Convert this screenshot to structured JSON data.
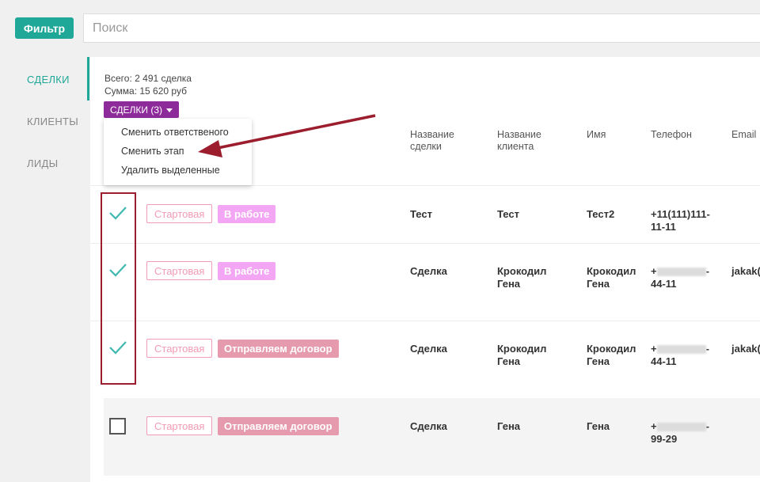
{
  "topbar": {
    "filter_label": "Фильтр",
    "search_placeholder": "Поиск"
  },
  "sidebar": {
    "items": [
      {
        "label": "СДЕЛКИ",
        "active": true
      },
      {
        "label": "КЛИЕНТЫ",
        "active": false
      },
      {
        "label": "ЛИДЫ",
        "active": false
      }
    ]
  },
  "summary": {
    "total": "Всего: 2 491 сделка",
    "sum": "Сумма: 15 620 руб"
  },
  "deals_button": "СДЕЛКИ (3)",
  "dropdown": {
    "items": [
      "Сменить ответственого",
      "Сменить этап",
      "Удалить выделенные"
    ]
  },
  "columns": {
    "deal_name": [
      "Название",
      "сделки"
    ],
    "client_name": [
      "Название",
      "клиента"
    ],
    "name": "Имя",
    "phone": "Телефон",
    "email": "Email"
  },
  "rows": [
    {
      "checked": true,
      "stage_start": "Стартовая",
      "stage": "В работе",
      "deal": "Тест",
      "client": [
        "Тест"
      ],
      "name": [
        "Тест2"
      ],
      "phone": [
        "+11(111)111-",
        "11-11"
      ],
      "email": ""
    },
    {
      "checked": true,
      "stage_start": "Стартовая",
      "stage": "В работе",
      "deal": "Сделка",
      "client": [
        "Крокодил",
        "Гена"
      ],
      "name": [
        "Крокодил",
        "Гена"
      ],
      "phone": [
        "+",
        "44-11"
      ],
      "email": "jakak("
    },
    {
      "checked": true,
      "stage_start": "Стартовая",
      "stage": "Отправляем договор",
      "deal": "Сделка",
      "client": [
        "Крокодил",
        "Гена"
      ],
      "name": [
        "Крокодил",
        "Гена"
      ],
      "phone": [
        "+",
        "44-11"
      ],
      "email": "jakak("
    },
    {
      "checked": false,
      "stage_start": "Стартовая",
      "stage": "Отправляем договор",
      "deal": "Сделка",
      "client": [
        "Гена"
      ],
      "name": [
        "Гена"
      ],
      "phone": [
        "+",
        "99-29"
      ],
      "email": ""
    }
  ],
  "colors": {
    "accent": "#1fa797",
    "deals_button": "#8e2b9a",
    "highlight": "#9b1d2e",
    "tag_work": "#f3a6f3",
    "tag_contract": "#e69aae"
  }
}
